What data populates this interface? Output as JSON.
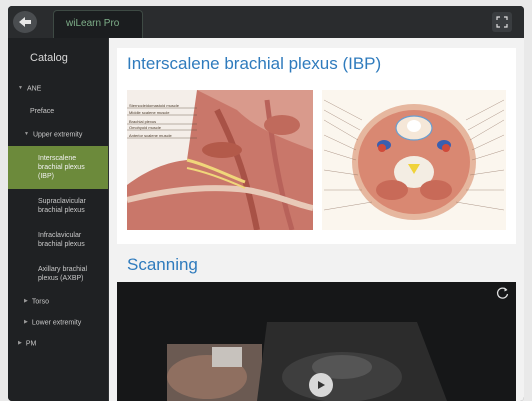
{
  "app": {
    "tab_label": "wiLearn Pro"
  },
  "icons": {
    "back": "arrow-left-icon",
    "fullscreen": "fullscreen-icon",
    "play": "play-icon",
    "replay": "replay-icon"
  },
  "colors": {
    "accent_active": "#6c8a3b",
    "heading": "#2f7bbd"
  },
  "sidebar": {
    "title": "Catalog",
    "items": [
      {
        "label": "ANE"
      },
      {
        "label": "Preface"
      },
      {
        "label": "Upper extremity"
      },
      {
        "label": "Interscalene brachial plexus (IBP)"
      },
      {
        "label": "Supraclavicular brachial plexus"
      },
      {
        "label": "Infraclavicular brachial plexus"
      },
      {
        "label": "Axillary brachial plexus (AXBP)"
      },
      {
        "label": "Torso"
      },
      {
        "label": "Lower extremity"
      },
      {
        "label": "PM"
      }
    ]
  },
  "main": {
    "section1": {
      "title": "Interscalene brachial plexus (IBP)",
      "figure1_labels": [
        "Sternocleidomastoid muscle",
        "Middle scalene muscle",
        "Brachial plexus",
        "Omohyoid muscle",
        "Anterior scalene muscle"
      ]
    },
    "section2": {
      "title": "Scanning"
    }
  }
}
